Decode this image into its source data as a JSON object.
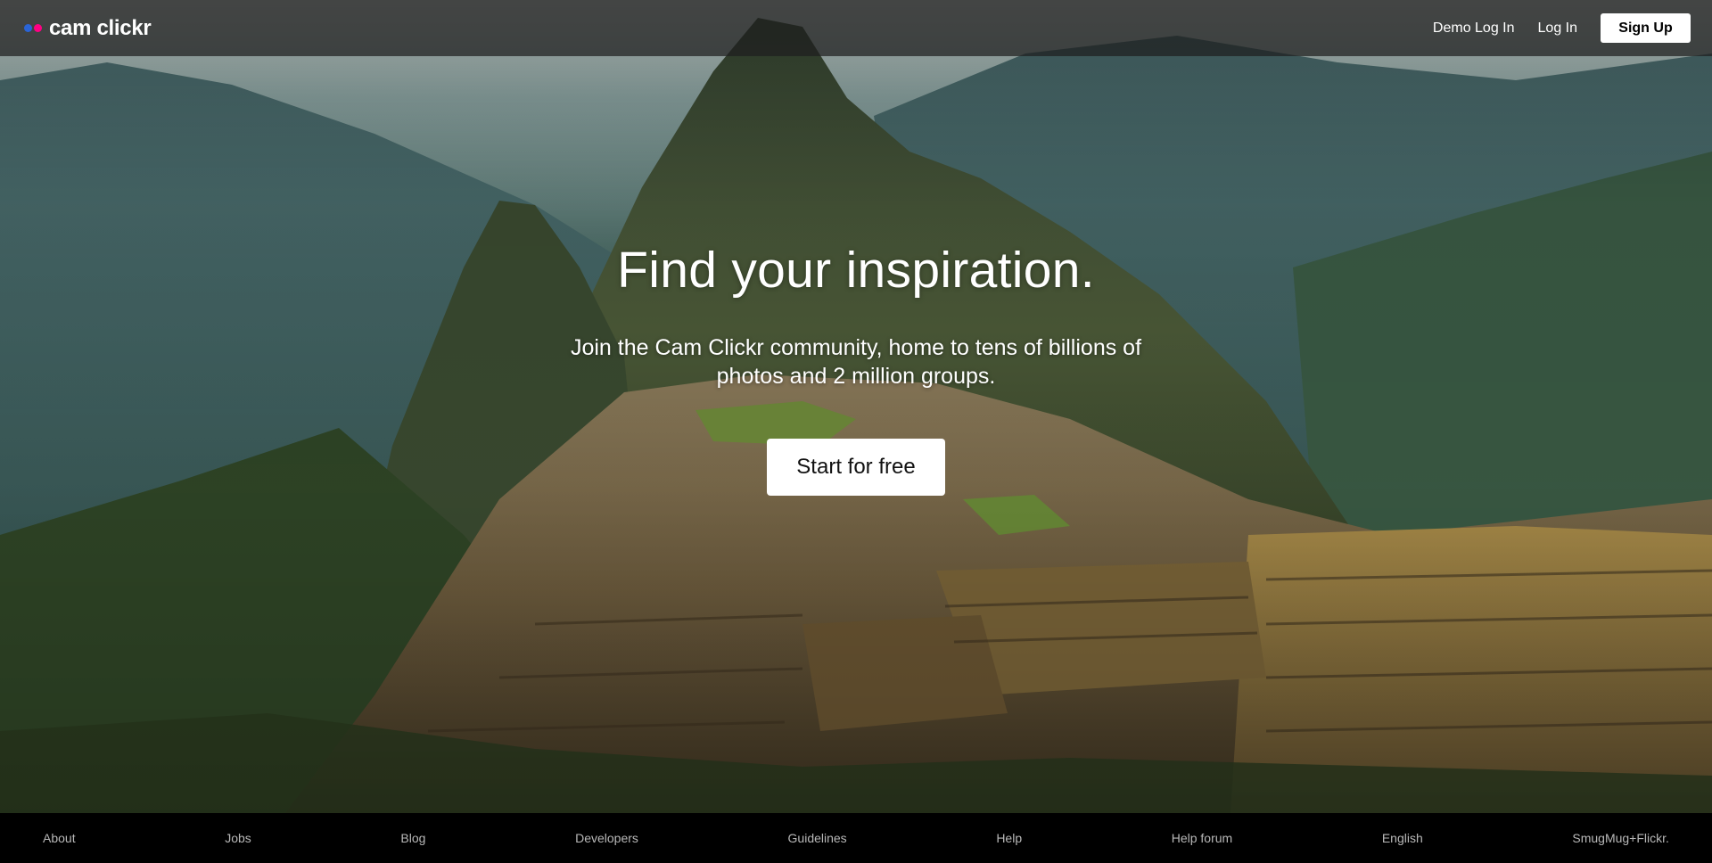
{
  "brand": {
    "name": "cam clickr",
    "dot_colors": [
      "#2a64d6",
      "#ff0084"
    ]
  },
  "nav": {
    "demo_login": "Demo Log In",
    "login": "Log In",
    "signup": "Sign Up"
  },
  "hero": {
    "title": "Find your inspiration.",
    "subtitle": "Join the Cam Clickr community, home to tens of billions of photos and 2 million groups.",
    "cta": "Start for free"
  },
  "footer": {
    "links": [
      "About",
      "Jobs",
      "Blog",
      "Developers",
      "Guidelines",
      "Help",
      "Help forum",
      "English",
      "SmugMug+Flickr."
    ]
  },
  "colors": {
    "topbar_bg": "rgba(30,30,30,0.72)",
    "footer_bg": "#000000",
    "footer_text": "#b8b8b8",
    "button_bg": "#ffffff"
  }
}
